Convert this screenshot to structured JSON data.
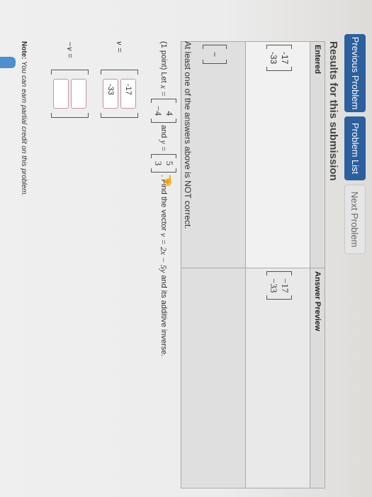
{
  "nav": {
    "previous": "Previous Problem",
    "list": "Problem List",
    "next": "Next Problem"
  },
  "results": {
    "heading": "Results for this submission",
    "col_entered": "Entered",
    "col_preview": "Answer Preview",
    "row1": {
      "entered": [
        "-17",
        "-33"
      ],
      "preview": [
        "−17",
        "−33"
      ]
    },
    "row2": {
      "entered": [
        "−"
      ],
      "preview": []
    }
  },
  "message": "At least one of the answers above is NOT correct.",
  "problem": {
    "points": "(1 point) Let",
    "x_label": "x =",
    "x_vals": [
      "4",
      "−4"
    ],
    "and": "and",
    "y_label": "y =",
    "y_vals": [
      "5",
      "3"
    ],
    "find": ". Find the vector",
    "expr": "v = 2x − 5y",
    "tail": "and its additive inverse."
  },
  "answers": {
    "v_label": "v =",
    "v_values": [
      "-17",
      "-33"
    ],
    "neg_label": "−v =",
    "neg_values": [
      "",
      ""
    ]
  },
  "note": {
    "label": "Note:",
    "text": " You can earn partial credit on this problem."
  }
}
